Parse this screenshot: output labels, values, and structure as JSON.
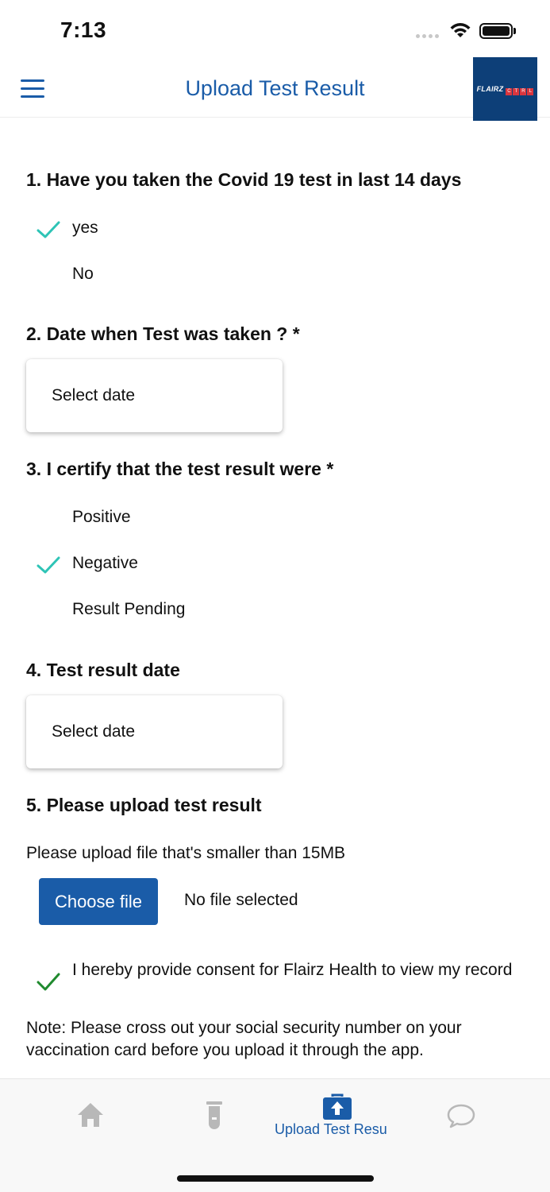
{
  "status_bar": {
    "time": "7:13"
  },
  "header": {
    "title": "Upload Test Result",
    "logo_text": "FLAIRZ",
    "logo_ctrl": [
      "C",
      "T",
      "R",
      "L"
    ]
  },
  "q1": {
    "title": "1. Have you taken the Covid 19 test in last 14 days",
    "options": [
      {
        "label": "yes",
        "checked": true
      },
      {
        "label": "No",
        "checked": false
      }
    ]
  },
  "q2": {
    "title": "2. Date when Test was taken ? *",
    "date_placeholder": "Select date"
  },
  "q3": {
    "title": "3. I certify that the test result were *",
    "options": [
      {
        "label": "Positive",
        "checked": false
      },
      {
        "label": "Negative",
        "checked": true
      },
      {
        "label": "Result Pending",
        "checked": false
      }
    ]
  },
  "q4": {
    "title": "4. Test result date",
    "date_placeholder": "Select date"
  },
  "q5": {
    "title": "5. Please upload test result",
    "note": "Please upload file that's smaller than 15MB",
    "choose_button": "Choose file",
    "file_status": "No file selected"
  },
  "consent": {
    "text": "I hereby provide consent for Flairz Health to view my record",
    "checked": true
  },
  "note": "Note: Please cross out your social security number on your vaccination card before you upload it through the app.",
  "tab_bar": {
    "active_label": "Upload Test Resu",
    "icons": [
      "home-icon",
      "test-tube-icon",
      "upload-briefcase-icon",
      "chat-icon"
    ]
  },
  "colors": {
    "primary": "#1a5ca8",
    "check_teal": "#2ec4b6",
    "check_green": "#1f8a2e",
    "tab_inactive": "#b8b8b8"
  }
}
